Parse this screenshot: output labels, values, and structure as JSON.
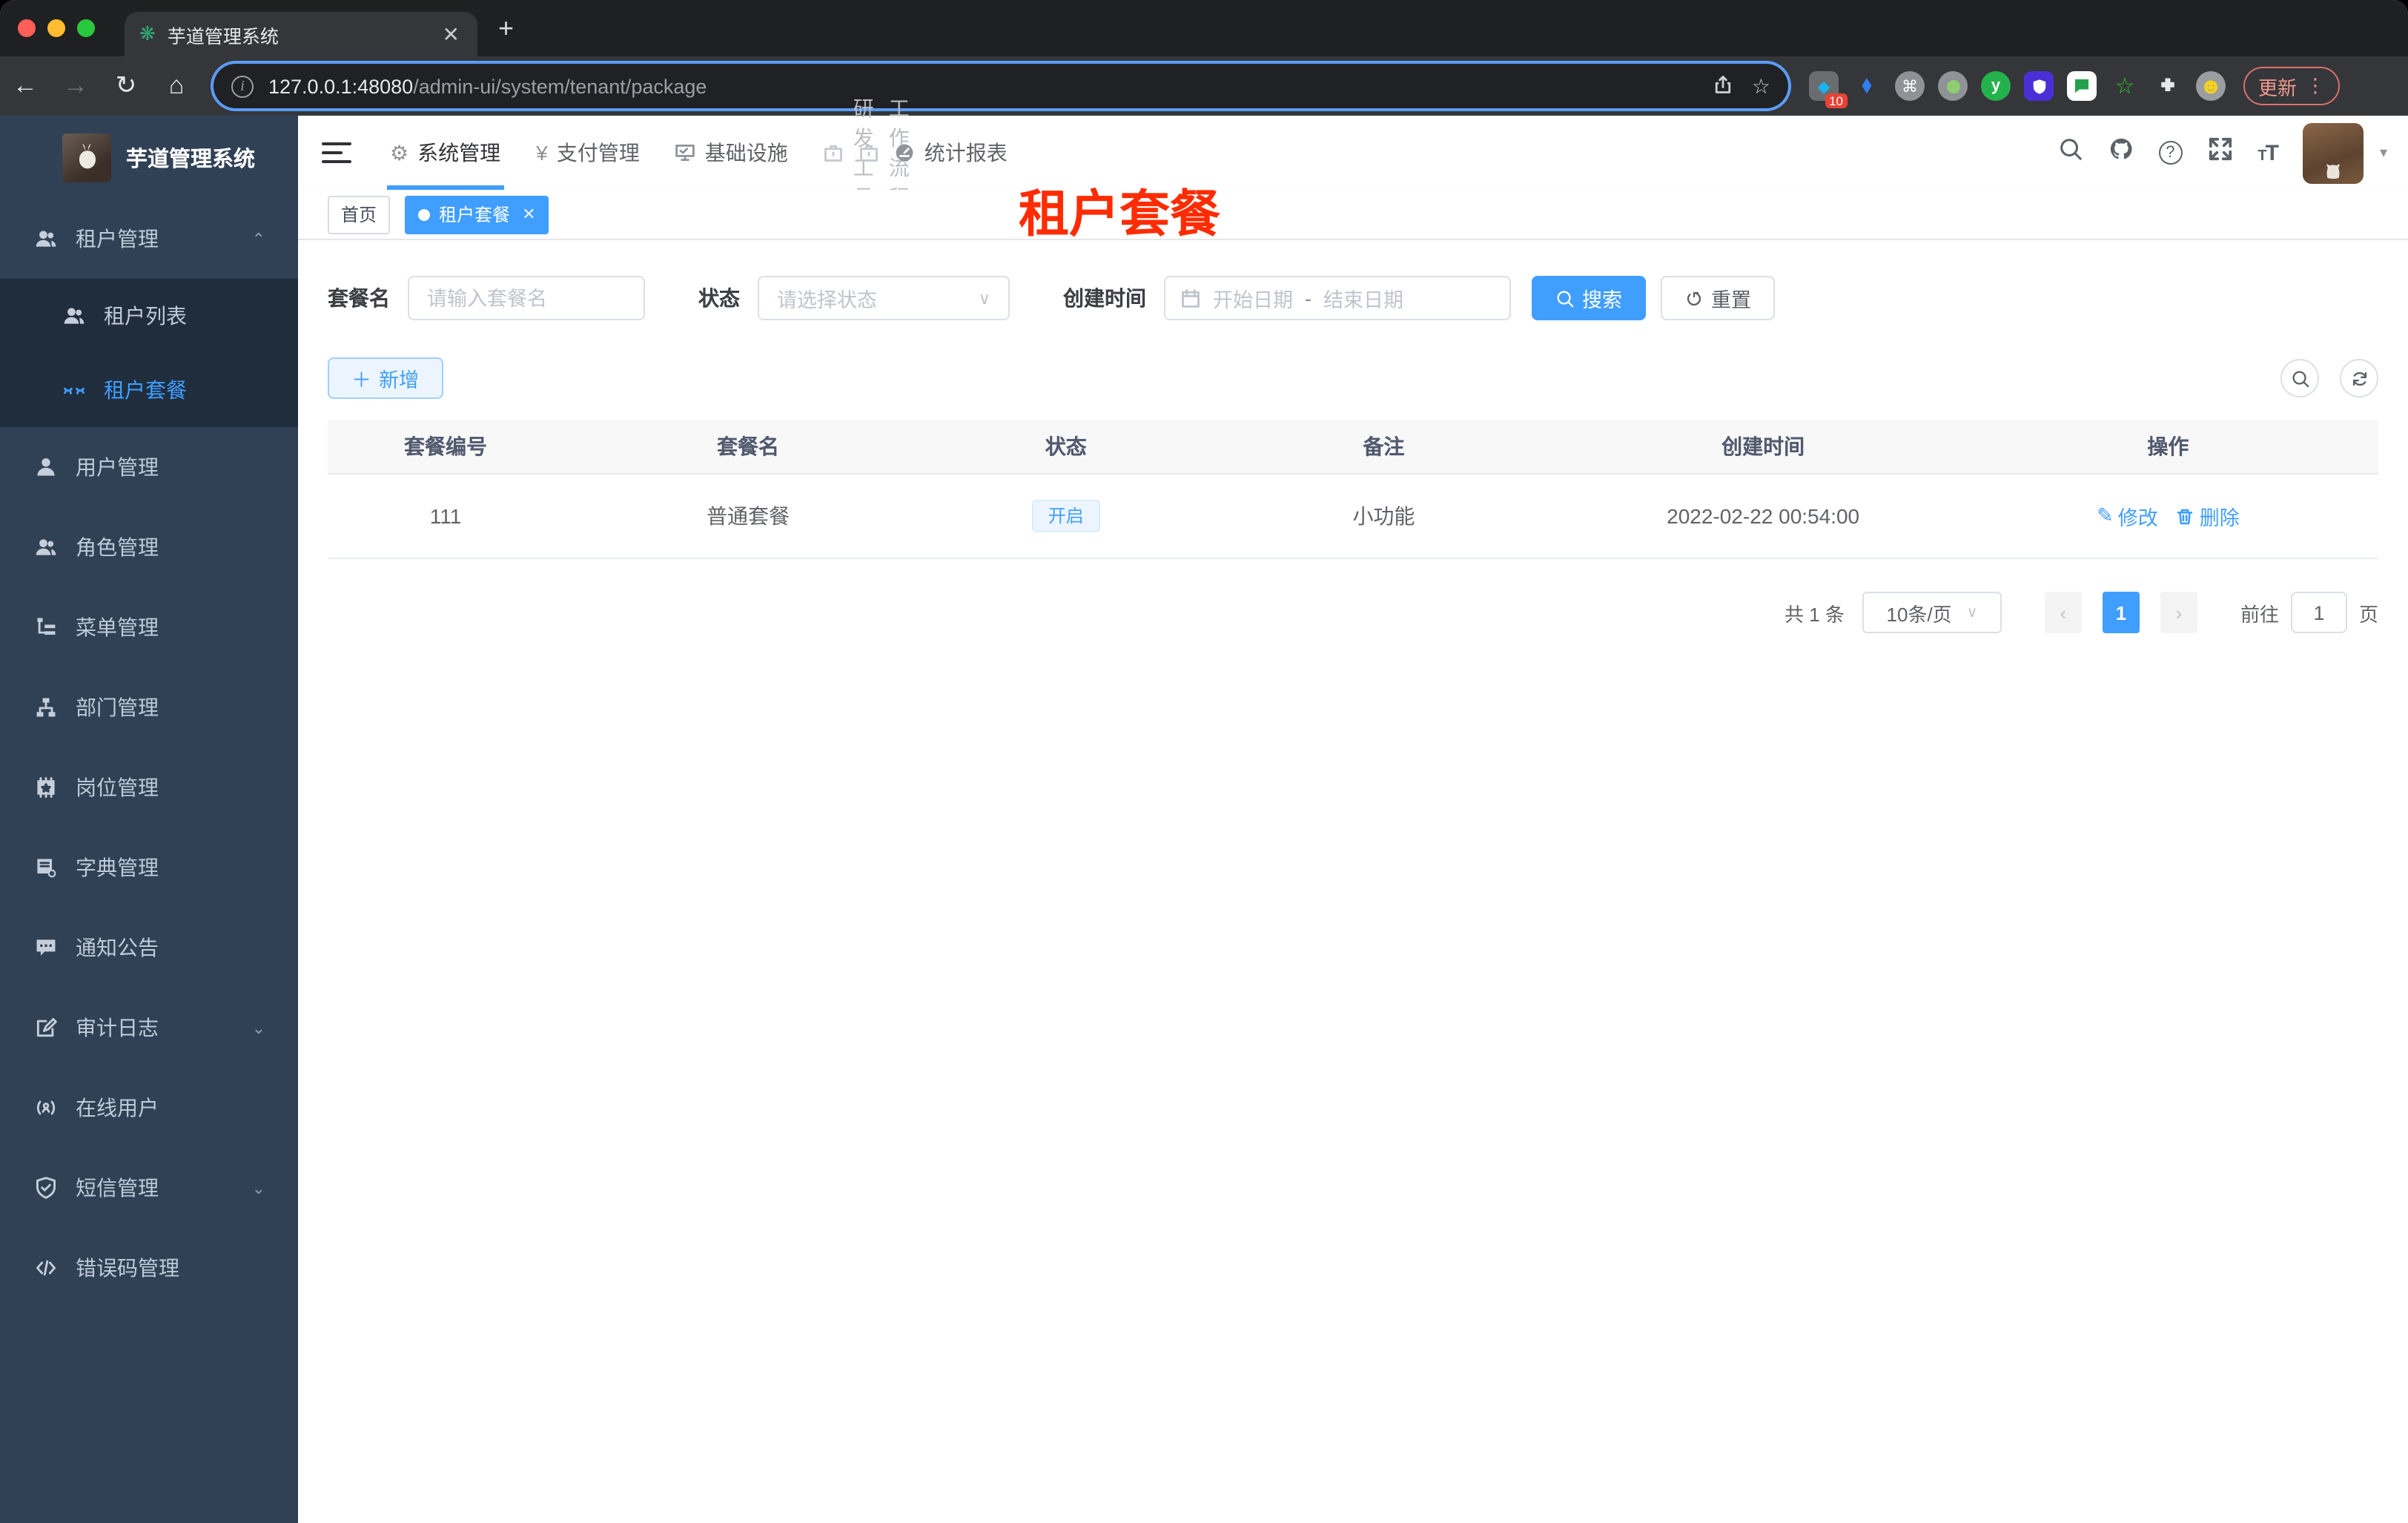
{
  "browser": {
    "tab_title": "芋道管理系统",
    "url_host": "127.0.0.1:48080",
    "url_path": "/admin-ui/system/tenant/package",
    "extensions_badge": "10",
    "update_label": "更新"
  },
  "sidebar": {
    "title": "芋道管理系统",
    "tenant": {
      "label": "租户管理",
      "children": [
        {
          "label": "租户列表"
        },
        {
          "label": "租户套餐"
        }
      ]
    },
    "items": [
      {
        "label": "用户管理"
      },
      {
        "label": "角色管理"
      },
      {
        "label": "菜单管理"
      },
      {
        "label": "部门管理"
      },
      {
        "label": "岗位管理"
      },
      {
        "label": "字典管理"
      },
      {
        "label": "通知公告"
      },
      {
        "label": "审计日志"
      },
      {
        "label": "在线用户"
      },
      {
        "label": "短信管理"
      },
      {
        "label": "错误码管理"
      }
    ]
  },
  "topnav": {
    "items": [
      {
        "label": "系统管理"
      },
      {
        "label": "支付管理"
      },
      {
        "label": "基础设施"
      },
      {
        "label": "研发工具"
      },
      {
        "label": "工作流程"
      },
      {
        "label": "统计报表"
      }
    ]
  },
  "tags": {
    "home": "首页",
    "active": "租户套餐"
  },
  "page_title": "租户套餐",
  "filters": {
    "name_label": "套餐名",
    "name_placeholder": "请输入套餐名",
    "status_label": "状态",
    "status_placeholder": "请选择状态",
    "date_label": "创建时间",
    "date_start": "开始日期",
    "date_sep": "-",
    "date_end": "结束日期",
    "search": "搜索",
    "reset": "重置"
  },
  "toolbar": {
    "add": "新增"
  },
  "table": {
    "columns": [
      "套餐编号",
      "套餐名",
      "状态",
      "备注",
      "创建时间",
      "操作"
    ],
    "row": {
      "id": "111",
      "name": "普通套餐",
      "status": "开启",
      "remark": "小功能",
      "created": "2022-02-22 00:54:00"
    },
    "edit": "修改",
    "delete": "删除"
  },
  "pagination": {
    "total": "共 1 条",
    "page_size": "10条/页",
    "page": "1",
    "goto_label": "前往",
    "goto_value": "1",
    "unit": "页"
  },
  "colors": {
    "accent": "#409eff",
    "title_red": "#fe2c00",
    "sidebar_bg": "#304156",
    "submenu_bg": "#1f2d3d"
  }
}
